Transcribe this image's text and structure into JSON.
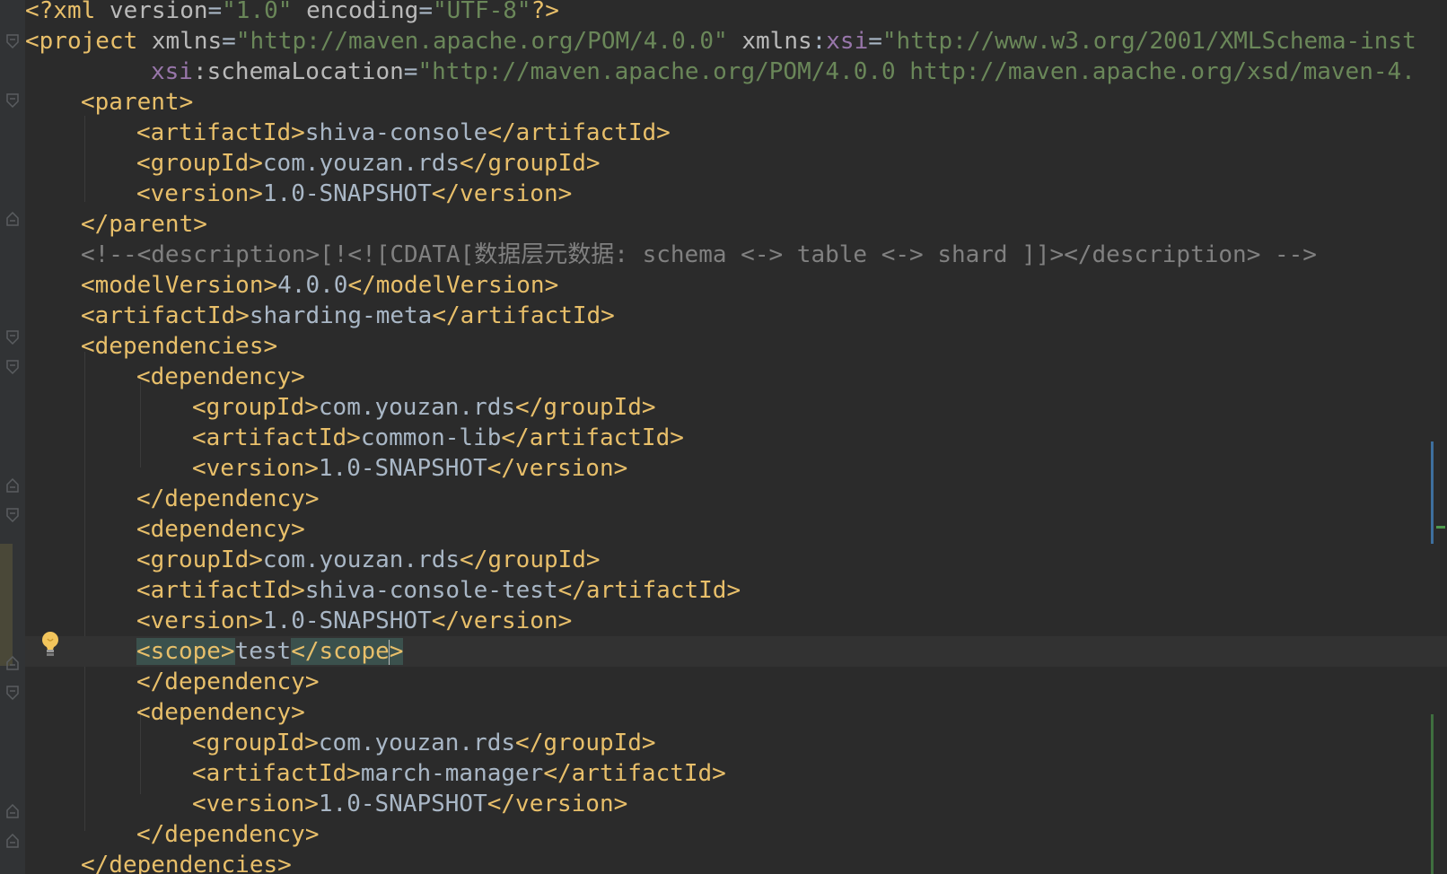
{
  "editor": {
    "file_type": "xml",
    "caret_line": 22,
    "colors": {
      "background": "#2b2b2b",
      "tag": "#e8bf6a",
      "attribute": "#bababa",
      "namespace": "#9876aa",
      "string": "#6a8759",
      "comment": "#808080",
      "text": "#a9b7c6",
      "current_line": "#323232"
    },
    "icons": {
      "intention": "lightbulb-icon",
      "fold": "fold-marker-icon"
    },
    "lines": {
      "l1": {
        "a": "<?xml ",
        "b": "version",
        "c": "=",
        "d": "\"1.0\"",
        "e": " encoding",
        "f": "=",
        "g": "\"UTF-8\"",
        "h": "?>"
      },
      "l2": {
        "a": "<project ",
        "b": "xmlns",
        "c": "=",
        "d": "\"http://maven.apache.org/POM/4.0.0\"",
        "e": " xmlns",
        "f": ":",
        "g": "xsi",
        "h": "=",
        "i": "\"http://www.w3.org/2001/XMLSchema-inst"
      },
      "l3": {
        "a": "xsi",
        "b": ":schemaLocation",
        "c": "=",
        "d": "\"http://maven.apache.org/POM/4.0.0 http://maven.apache.org/xsd/maven-4."
      },
      "l4": {
        "a": "<parent>"
      },
      "l5": {
        "a": "<artifactId>",
        "b": "shiva-console",
        "c": "</artifactId>"
      },
      "l6": {
        "a": "<groupId>",
        "b": "com.youzan.rds",
        "c": "</groupId>"
      },
      "l7": {
        "a": "<version>",
        "b": "1.0-SNAPSHOT",
        "c": "</version>"
      },
      "l8": {
        "a": "</parent>"
      },
      "l9": {
        "a": "<!--<description>[!<![CDATA[数据层元数据: schema <-> table <-> shard ]]></description> -->"
      },
      "l10": {
        "a": "<modelVersion>",
        "b": "4.0.0",
        "c": "</modelVersion>"
      },
      "l11": {
        "a": "<artifactId>",
        "b": "sharding-meta",
        "c": "</artifactId>"
      },
      "l12": {
        "a": "<dependencies>"
      },
      "l13": {
        "a": "<dependency>"
      },
      "l14": {
        "a": "<groupId>",
        "b": "com.youzan.rds",
        "c": "</groupId>"
      },
      "l15": {
        "a": "<artifactId>",
        "b": "common-lib",
        "c": "</artifactId>"
      },
      "l16": {
        "a": "<version>",
        "b": "1.0-SNAPSHOT",
        "c": "</version>"
      },
      "l17": {
        "a": "</dependency>"
      },
      "l18": {
        "a": "<dependency>"
      },
      "l19": {
        "a": "<groupId>",
        "b": "com.youzan.rds",
        "c": "</groupId>"
      },
      "l20": {
        "a": "<artifactId>",
        "b": "shiva-console-test",
        "c": "</artifactId>"
      },
      "l21": {
        "a": "<version>",
        "b": "1.0-SNAPSHOT",
        "c": "</version>"
      },
      "l22": {
        "a": "<scope>",
        "b": "test",
        "c": "</scope",
        "d": ">"
      },
      "l23": {
        "a": "</dependency>"
      },
      "l24": {
        "a": "<dependency>"
      },
      "l25": {
        "a": "<groupId>",
        "b": "com.youzan.rds",
        "c": "</groupId>"
      },
      "l26": {
        "a": "<artifactId>",
        "b": "march-manager",
        "c": "</artifactId>"
      },
      "l27": {
        "a": "<version>",
        "b": "1.0-SNAPSHOT",
        "c": "</version>"
      },
      "l28": {
        "a": "</dependency>"
      },
      "l29": {
        "a": "</dependencies>"
      }
    }
  }
}
